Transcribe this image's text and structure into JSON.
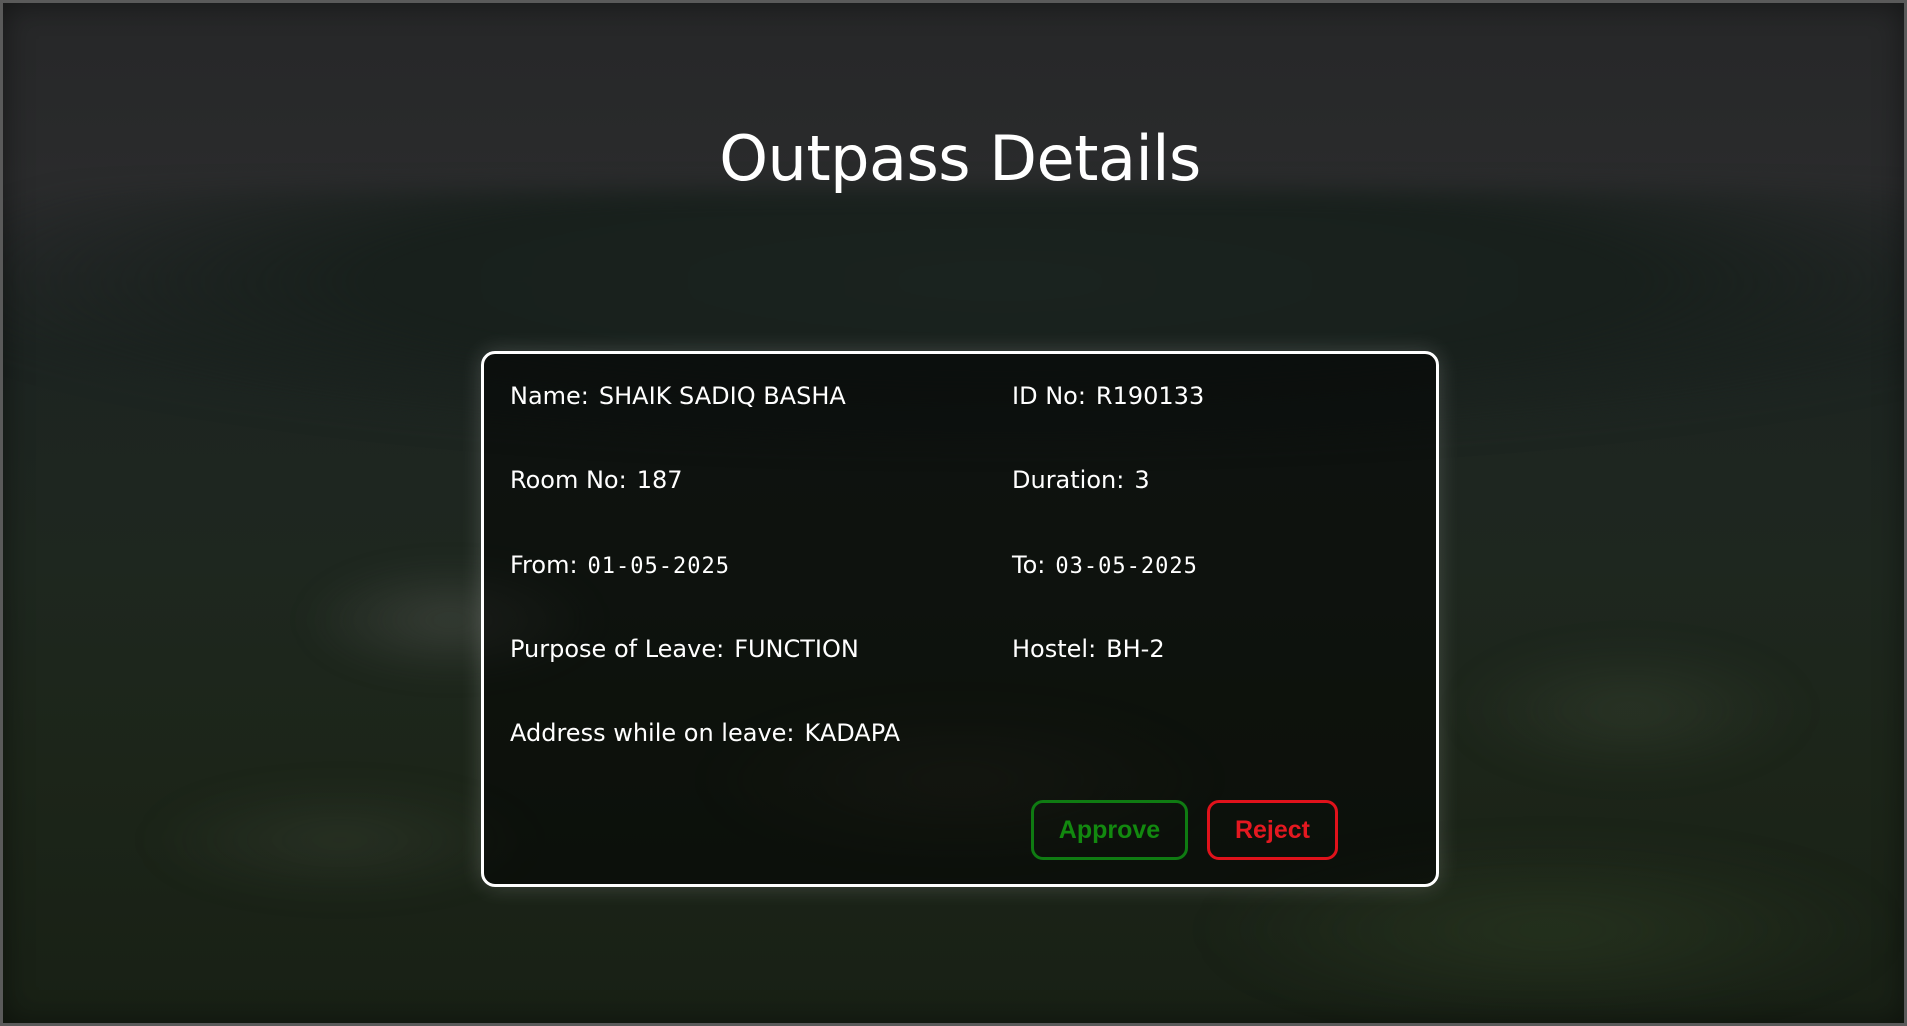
{
  "page": {
    "title": "Outpass Details"
  },
  "details": {
    "name": {
      "label": "Name:",
      "value": "SHAIK SADIQ BASHA"
    },
    "id_no": {
      "label": "ID No:",
      "value": "R190133"
    },
    "room_no": {
      "label": "Room No:",
      "value": "187"
    },
    "duration": {
      "label": "Duration:",
      "value": "3"
    },
    "from": {
      "label": "From:",
      "value": "01-05-2025"
    },
    "to": {
      "label": "To:",
      "value": "03-05-2025"
    },
    "purpose": {
      "label": "Purpose of Leave:",
      "value": "FUNCTION"
    },
    "hostel": {
      "label": "Hostel:",
      "value": "BH-2"
    },
    "address": {
      "label": "Address while on leave:",
      "value": "KADAPA"
    }
  },
  "actions": {
    "approve_label": "Approve",
    "reject_label": "Reject"
  },
  "colors": {
    "approve": "#12890f",
    "reject": "#e41820",
    "card_border": "#ffffff"
  }
}
